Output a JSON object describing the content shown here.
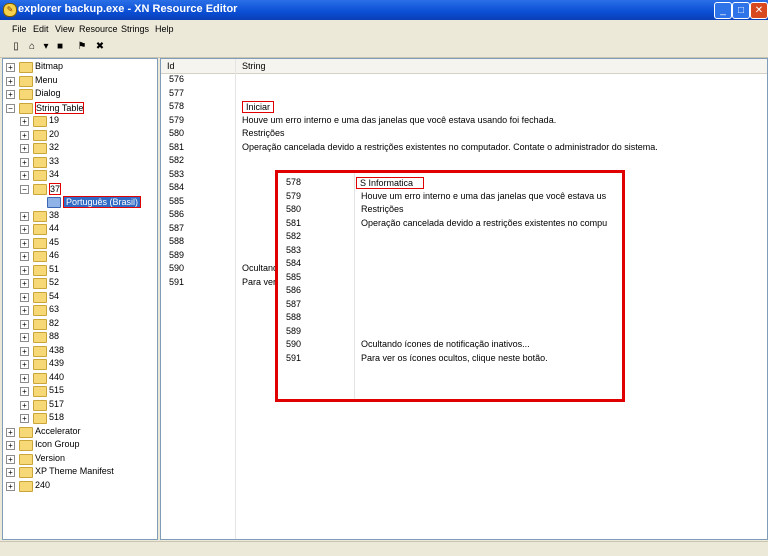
{
  "window": {
    "title": "explorer backup.exe - XN Resource Editor"
  },
  "menu": [
    "File",
    "Edit",
    "View",
    "Resource",
    "Strings",
    "Help"
  ],
  "tree": {
    "top": [
      "Bitmap",
      "Menu",
      "Dialog",
      "String Table"
    ],
    "string_children": [
      "19",
      "20",
      "32",
      "33",
      "34",
      "37"
    ],
    "selected_child": "Português (Brasil)",
    "after": [
      "38",
      "44",
      "45",
      "46",
      "51",
      "52",
      "54",
      "63",
      "82",
      "88",
      "438",
      "439",
      "440",
      "515",
      "517",
      "518"
    ],
    "bottom": [
      "Accelerator",
      "Icon Group",
      "Version",
      "XP Theme Manifest",
      "240"
    ]
  },
  "list": {
    "headers": {
      "id": "Id",
      "string": "String"
    },
    "rows": [
      {
        "id": "576",
        "text": ""
      },
      {
        "id": "577",
        "text": ""
      },
      {
        "id": "578",
        "text": "Iniciar"
      },
      {
        "id": "579",
        "text": "Houve um erro interno e uma das janelas que você estava usando foi fechada."
      },
      {
        "id": "580",
        "text": "Restrições"
      },
      {
        "id": "581",
        "text": "Operação cancelada devido a restrições existentes no computador. Contate o administrador do sistema."
      },
      {
        "id": "582",
        "text": ""
      },
      {
        "id": "583",
        "text": ""
      },
      {
        "id": "584",
        "text": ""
      },
      {
        "id": "585",
        "text": ""
      },
      {
        "id": "586",
        "text": ""
      },
      {
        "id": "587",
        "text": ""
      },
      {
        "id": "588",
        "text": ""
      },
      {
        "id": "589",
        "text": ""
      },
      {
        "id": "590",
        "text": "Ocultand"
      },
      {
        "id": "591",
        "text": "Para ver"
      }
    ]
  },
  "callout": {
    "rows": [
      {
        "id": "578",
        "text": "S Informatica"
      },
      {
        "id": "579",
        "text": "Houve um erro interno e uma das janelas que você estava us"
      },
      {
        "id": "580",
        "text": "Restrições"
      },
      {
        "id": "581",
        "text": "Operação cancelada devido a restrições existentes no compu"
      },
      {
        "id": "582",
        "text": ""
      },
      {
        "id": "583",
        "text": ""
      },
      {
        "id": "584",
        "text": ""
      },
      {
        "id": "585",
        "text": ""
      },
      {
        "id": "586",
        "text": ""
      },
      {
        "id": "587",
        "text": ""
      },
      {
        "id": "588",
        "text": ""
      },
      {
        "id": "589",
        "text": ""
      },
      {
        "id": "590",
        "text": "Ocultando ícones de notificação inativos..."
      },
      {
        "id": "591",
        "text": "Para ver os ícones ocultos, clique neste botão."
      }
    ]
  }
}
